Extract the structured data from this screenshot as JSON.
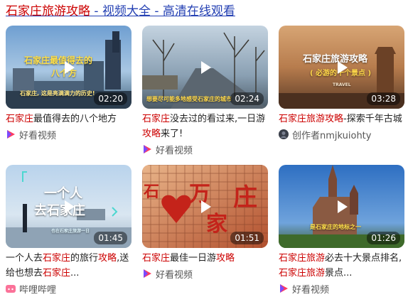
{
  "page": {
    "title_part1": "石家庄",
    "title_part2": "旅游攻略",
    "title_part3": " - 视频大全 - 高清在线观看"
  },
  "cards": [
    {
      "duration": "02:20",
      "overlay1": "石家庄最值得去的",
      "overlay2": "八个方",
      "overlay3": "石家庄, 这是亮满满力的历史!",
      "caption": [
        {
          "t": "石家庄",
          "h": true
        },
        {
          "t": "最值得去的八个地方",
          "h": false
        }
      ],
      "source": "好看视频",
      "source_icon": "haokan-icon"
    },
    {
      "duration": "02:24",
      "overlay1": "想要尽可能多地感受石家庄的城市",
      "caption": [
        {
          "t": "石家庄",
          "h": true
        },
        {
          "t": "没去过的看过来,一日游",
          "h": false
        },
        {
          "t": "攻略",
          "h": true
        },
        {
          "t": "来了!",
          "h": false
        }
      ],
      "source": "好看视频",
      "source_icon": "haokan-icon"
    },
    {
      "duration": "03:28",
      "overlay1": "石家庄旅游攻略",
      "overlay2": "( 必游的十个景点 )",
      "overlay3": "TRAVEL",
      "caption": [
        {
          "t": "石家庄旅游攻略",
          "h": true
        },
        {
          "t": "-探索千年古城",
          "h": false
        }
      ],
      "source": "创作者nmjkuiohty",
      "source_icon": "avatar-icon"
    },
    {
      "duration": "01:45",
      "overlay1": "一个人",
      "overlay2": "去石家庄",
      "overlay3": "也在石家庄旅游一日",
      "caption": [
        {
          "t": "一个人去",
          "h": false
        },
        {
          "t": "石家庄",
          "h": true
        },
        {
          "t": "的旅行",
          "h": false
        },
        {
          "t": "攻略",
          "h": true
        },
        {
          "t": ",送给也想去",
          "h": false
        },
        {
          "t": "石家庄",
          "h": true
        },
        {
          "t": "...",
          "h": false
        }
      ],
      "source": "哔哩哔哩",
      "source_icon": "bilibili-icon"
    },
    {
      "duration": "01:51",
      "overlay1": "石",
      "overlay2": "万",
      "overlay3": "庄",
      "overlay4": "家",
      "caption": [
        {
          "t": "石家庄",
          "h": true
        },
        {
          "t": "最佳一日游",
          "h": false
        },
        {
          "t": "攻略",
          "h": true
        }
      ],
      "source": "好看视频",
      "source_icon": "haokan-icon"
    },
    {
      "duration": "01:26",
      "overlay1": "是石家庄的地标之一",
      "caption": [
        {
          "t": "石家庄旅游",
          "h": true
        },
        {
          "t": "必去十大景点排名,",
          "h": false
        },
        {
          "t": "石家庄旅游",
          "h": true
        },
        {
          "t": "景点...",
          "h": false
        }
      ],
      "source": "好看视频",
      "source_icon": "haokan-icon"
    }
  ]
}
